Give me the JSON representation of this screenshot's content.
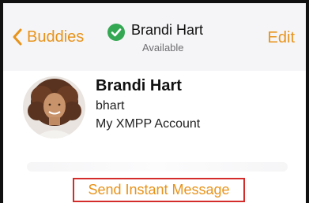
{
  "navbar": {
    "back_label": "Buddies",
    "title_name": "Brandi Hart",
    "title_status": "Available",
    "edit_label": "Edit",
    "back_icon": "chevron-left-icon",
    "status_icon": "check-circle-icon"
  },
  "profile": {
    "name": "Brandi Hart",
    "username": "bhart",
    "account": "My XMPP Account"
  },
  "actions": {
    "send_message_label": "Send Instant Message"
  },
  "colors": {
    "accent": "#e8931a",
    "status_green": "#34a853",
    "highlight_border": "#d42b2b"
  }
}
